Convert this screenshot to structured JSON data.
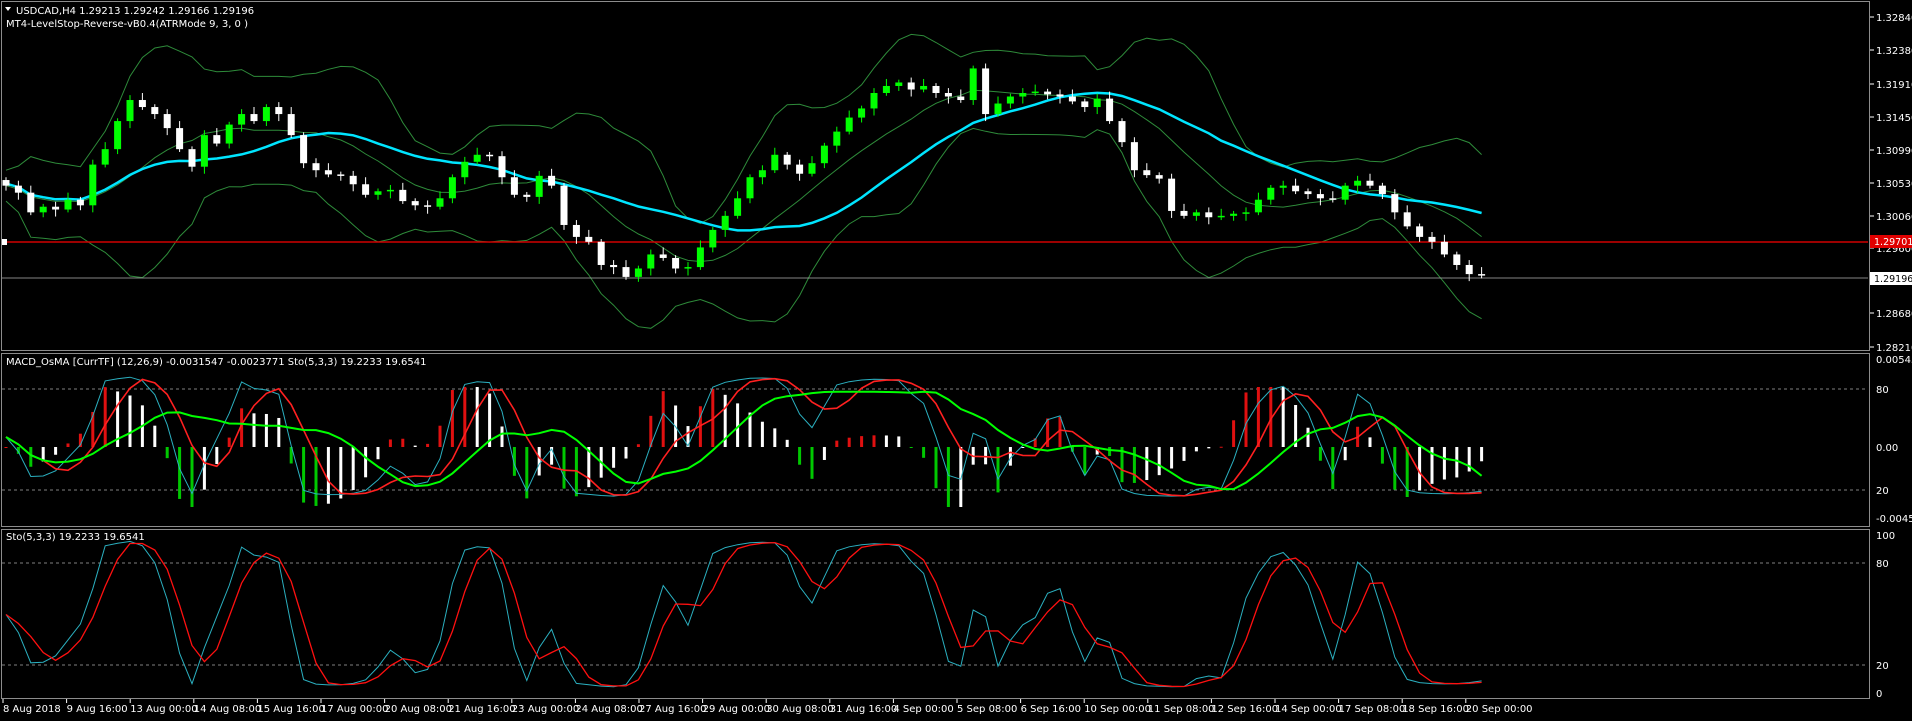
{
  "window": {
    "symbol_line": "USDCAD,H4  1.29213 1.29242 1.29166 1.29196",
    "indicator_line": "MT4-LevelStop-Reverse-vB0.4(ATRMode 9, 3, 0 )"
  },
  "main_axis": {
    "labels": [
      "1.32840",
      "1.32380",
      "1.31910",
      "1.31450",
      "1.30990",
      "1.30530",
      "1.30060",
      "1.29600",
      "1.28680",
      "1.28210"
    ],
    "current_price": "1.29196",
    "red_line_price": "1.29701"
  },
  "macd_panel": {
    "title": "MACD_OsMA [CurrTF] (12,26,9) -0.0031547 -0.0023771  Sto(5,3,3) 19.2233 19.6541",
    "axis_labels": [
      "0.005456",
      "80",
      "0.00",
      "20",
      "-0.004525"
    ]
  },
  "sto_panel": {
    "title": "Sto(5,3,3) 19.2233 19.6541",
    "axis_labels": [
      "100",
      "80",
      "20",
      "0"
    ]
  },
  "time_axis": {
    "labels": [
      "8 Aug 2018",
      "9 Aug 16:00",
      "13 Aug 00:00",
      "14 Aug 08:00",
      "15 Aug 16:00",
      "17 Aug 00:00",
      "20 Aug 08:00",
      "21 Aug 16:00",
      "23 Aug 00:00",
      "24 Aug 08:00",
      "27 Aug 16:00",
      "29 Aug 00:00",
      "30 Aug 08:00",
      "31 Aug 16:00",
      "4 Sep 00:00",
      "5 Sep 08:00",
      "6 Sep 16:00",
      "10 Sep 00:00",
      "11 Sep 08:00",
      "12 Sep 16:00",
      "14 Sep 00:00",
      "17 Sep 08:00",
      "18 Sep 16:00",
      "20 Sep 00:00"
    ]
  },
  "colors": {
    "background": "#000000",
    "bull_candle": "#00ff00",
    "bear_candle": "#ffffff",
    "ma_line": "#00e5ff",
    "bands": "#2e8b3a",
    "level_line": "#d00000",
    "hist_up": "#e01010",
    "hist_down": "#00c800",
    "hist_neutral": "#ffffff",
    "macd_green": "#00ff00",
    "macd_red": "#ff2020",
    "sto_main": "#2bb0c0",
    "sto_signal": "#ff1010"
  },
  "chart_data": {
    "type": "candlestick",
    "closes": [
      1.3048,
      1.3038,
      1.301,
      1.3018,
      1.3014,
      1.3028,
      1.302,
      1.3078,
      1.31,
      1.314,
      1.317,
      1.316,
      1.315,
      1.313,
      1.31,
      1.3075,
      1.312,
      1.3108,
      1.3135,
      1.315,
      1.314,
      1.316,
      1.315,
      1.312,
      1.308,
      1.307,
      1.3064,
      1.3062,
      1.305,
      1.3035,
      1.304,
      1.3042,
      1.3026,
      1.302,
      1.3018,
      1.303,
      1.306,
      1.3082,
      1.3092,
      1.309,
      1.306,
      1.3035,
      1.3032,
      1.3062,
      1.3048,
      1.2992,
      1.2975,
      1.2968,
      1.2935,
      1.2932,
      1.2918,
      1.293,
      1.295,
      1.2945,
      1.293,
      1.2932,
      1.296,
      1.2985,
      1.3005,
      1.303,
      1.306,
      1.307,
      1.3092,
      1.3078,
      1.3065,
      1.308,
      1.3105,
      1.3125,
      1.3145,
      1.3158,
      1.318,
      1.319,
      1.3195,
      1.3185,
      1.319,
      1.318,
      1.3175,
      1.317,
      1.3215,
      1.315,
      1.3165,
      1.3175,
      1.318,
      1.3182,
      1.3178,
      1.3175,
      1.3168,
      1.316,
      1.3172,
      1.314,
      1.311,
      1.307,
      1.3063,
      1.3058,
      1.3012,
      1.3005,
      1.301,
      1.3003,
      1.3005,
      1.3008,
      1.301,
      1.3028,
      1.3045,
      1.3048,
      1.304,
      1.3036,
      1.303,
      1.3028,
      1.3048,
      1.3055,
      1.3048,
      1.3036,
      1.301,
      1.299,
      1.2975,
      1.2968,
      1.295,
      1.2935,
      1.2922,
      1.292
    ]
  }
}
